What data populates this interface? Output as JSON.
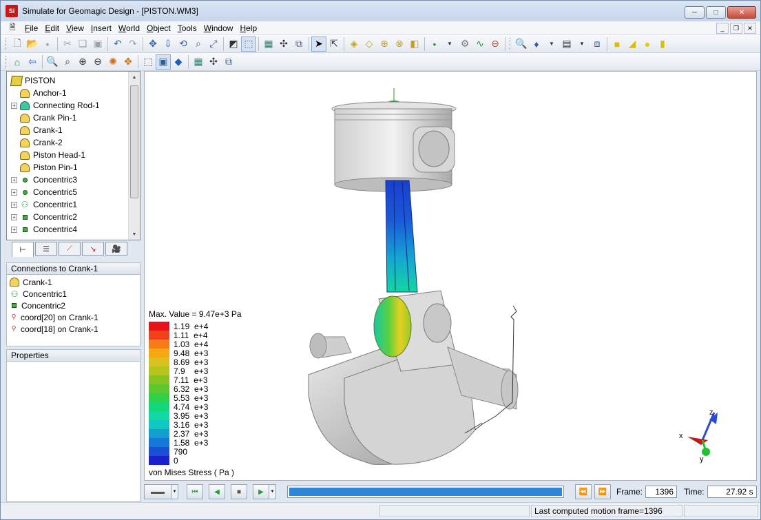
{
  "window": {
    "title": "Simulate for Geomagic Design - [PISTON.WM3]",
    "app_icon_text": "Si",
    "minimize": "─",
    "maximize": "□",
    "close": "✕"
  },
  "menu": {
    "items": [
      "File",
      "Edit",
      "View",
      "Insert",
      "World",
      "Object",
      "Tools",
      "Window",
      "Help"
    ]
  },
  "tree": {
    "root": "PISTON",
    "items": [
      {
        "label": "Anchor-1",
        "icon": "part-icon",
        "expandable": false
      },
      {
        "label": "Connecting Rod-1",
        "icon": "rod-icon",
        "expandable": true
      },
      {
        "label": "Crank Pin-1",
        "icon": "part-icon",
        "expandable": false
      },
      {
        "label": "Crank-1",
        "icon": "part-icon",
        "expandable": false
      },
      {
        "label": "Crank-2",
        "icon": "part-icon",
        "expandable": false
      },
      {
        "label": "Piston Head-1",
        "icon": "part-icon",
        "expandable": false
      },
      {
        "label": "Piston Pin-1",
        "icon": "part-icon",
        "expandable": false
      },
      {
        "label": "Concentric3",
        "icon": "dot-icon",
        "expandable": true
      },
      {
        "label": "Concentric5",
        "icon": "dot-icon",
        "expandable": true
      },
      {
        "label": "Concentric1",
        "icon": "person-icon",
        "expandable": true
      },
      {
        "label": "Concentric2",
        "icon": "square-icon",
        "expandable": true
      },
      {
        "label": "Concentric4",
        "icon": "square-icon",
        "expandable": true
      }
    ]
  },
  "connections": {
    "header": "Connections to Crank-1",
    "items": [
      {
        "label": "Crank-1",
        "icon": "part-icon"
      },
      {
        "label": "Concentric1",
        "icon": "person-icon"
      },
      {
        "label": "Concentric2",
        "icon": "square-icon"
      },
      {
        "label": "coord[20] on Crank-1",
        "icon": "coord-icon"
      },
      {
        "label": "coord[18] on Crank-1",
        "icon": "coord-icon"
      }
    ]
  },
  "properties": {
    "header": "Properties"
  },
  "legend": {
    "max_value": "Max. Value = 9.47e+3 Pa",
    "title": "von Mises  Stress  ( Pa )",
    "entries": [
      {
        "label": "1.19  e+4",
        "color": "#e8101a"
      },
      {
        "label": "1.11  e+4",
        "color": "#f0421a"
      },
      {
        "label": "1.03  e+4",
        "color": "#f77a18"
      },
      {
        "label": "9.48  e+3",
        "color": "#f5a814"
      },
      {
        "label": "8.69  e+3",
        "color": "#d8c01e"
      },
      {
        "label": "7.9    e+3",
        "color": "#b6c51e"
      },
      {
        "label": "7.11  e+3",
        "color": "#86c424"
      },
      {
        "label": "6.32  e+3",
        "color": "#5ec62e"
      },
      {
        "label": "5.53  e+3",
        "color": "#2fd04a"
      },
      {
        "label": "4.74  e+3",
        "color": "#12d87a"
      },
      {
        "label": "3.95  e+3",
        "color": "#10d8a6"
      },
      {
        "label": "3.16  e+3",
        "color": "#12c6c4"
      },
      {
        "label": "2.37  e+3",
        "color": "#149ed0"
      },
      {
        "label": "1.58  e+3",
        "color": "#1678d8"
      },
      {
        "label": "790",
        "color": "#1a4fd6"
      },
      {
        "label": "0",
        "color": "#1a20cc"
      }
    ]
  },
  "playback": {
    "frame_label": "Frame:",
    "frame_value": "1396",
    "time_label": "Time:",
    "time_value": "27.92  s",
    "progress": 1.0
  },
  "status": {
    "message": "Last computed motion frame=1396"
  }
}
